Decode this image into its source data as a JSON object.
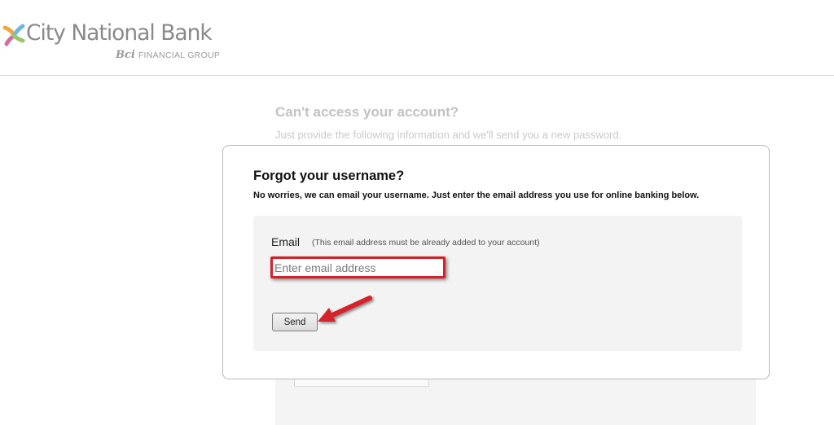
{
  "brand": {
    "name": "City National Bank",
    "sub_brand": "Bci",
    "sub_tagline": "FINANCIAL GROUP",
    "logo_colors": [
      "#f0a742",
      "#6db8e0",
      "#d56aa8",
      "#9bc56b"
    ]
  },
  "background_page": {
    "title": "Can't access your account?",
    "subtitle": "Just provide the following information and we'll send you a new password."
  },
  "modal": {
    "title": "Forgot your username?",
    "description": "No worries, we can email your username. Just enter the email address you use for online banking below.",
    "email_label": "Email",
    "email_hint": "(This email address must be already added to your account)",
    "email_value": "",
    "email_placeholder": "Enter email address",
    "send_label": "Send"
  },
  "annotations": {
    "highlight_color": "#d6202a",
    "arrow_icon": "red-arrow-icon"
  }
}
